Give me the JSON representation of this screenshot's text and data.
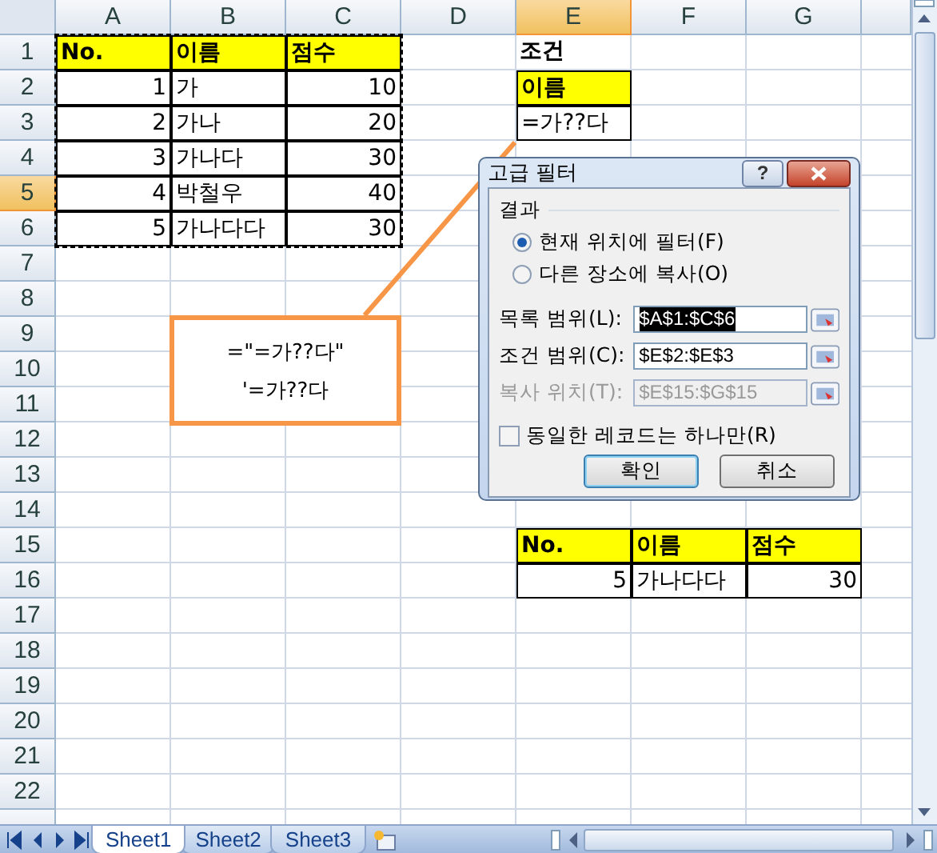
{
  "sheet": {
    "columns": [
      {
        "label": "A",
        "selected": false
      },
      {
        "label": "B",
        "selected": false
      },
      {
        "label": "C",
        "selected": false
      },
      {
        "label": "D",
        "selected": false
      },
      {
        "label": "E",
        "selected": true
      },
      {
        "label": "F",
        "selected": false
      },
      {
        "label": "G",
        "selected": false
      }
    ],
    "rows": [
      {
        "label": "1",
        "selected": false,
        "cells": {
          "A": {
            "text": "No.",
            "kind": "header"
          },
          "B": {
            "text": "이름",
            "kind": "header"
          },
          "C": {
            "text": "점수",
            "kind": "header"
          },
          "E": {
            "text": "조건",
            "kind": "title"
          }
        }
      },
      {
        "label": "2",
        "selected": false,
        "cells": {
          "A": {
            "text": "1",
            "kind": "number"
          },
          "B": {
            "text": "가",
            "kind": "text"
          },
          "C": {
            "text": "10",
            "kind": "number"
          },
          "E": {
            "text": "이름",
            "kind": "header"
          }
        }
      },
      {
        "label": "3",
        "selected": false,
        "cells": {
          "A": {
            "text": "2",
            "kind": "number"
          },
          "B": {
            "text": "가나",
            "kind": "text"
          },
          "C": {
            "text": "20",
            "kind": "number"
          },
          "E": {
            "text": "=가??다",
            "kind": "text"
          }
        }
      },
      {
        "label": "4",
        "selected": false,
        "cells": {
          "A": {
            "text": "3",
            "kind": "number"
          },
          "B": {
            "text": "가나다",
            "kind": "text"
          },
          "C": {
            "text": "30",
            "kind": "number"
          }
        }
      },
      {
        "label": "5",
        "selected": true,
        "cells": {
          "A": {
            "text": "4",
            "kind": "number"
          },
          "B": {
            "text": "박철우",
            "kind": "text"
          },
          "C": {
            "text": "40",
            "kind": "number"
          }
        }
      },
      {
        "label": "6",
        "selected": false,
        "cells": {
          "A": {
            "text": "5",
            "kind": "number"
          },
          "B": {
            "text": "가나다다",
            "kind": "text"
          },
          "C": {
            "text": "30",
            "kind": "number"
          }
        }
      },
      {
        "label": "7",
        "selected": false,
        "cells": {}
      },
      {
        "label": "8",
        "selected": false,
        "cells": {}
      },
      {
        "label": "9",
        "selected": false,
        "cells": {}
      },
      {
        "label": "10",
        "selected": false,
        "cells": {}
      },
      {
        "label": "11",
        "selected": false,
        "cells": {}
      },
      {
        "label": "12",
        "selected": false,
        "cells": {}
      },
      {
        "label": "13",
        "selected": false,
        "cells": {}
      },
      {
        "label": "14",
        "selected": false,
        "cells": {}
      },
      {
        "label": "15",
        "selected": false,
        "cells": {
          "E": {
            "text": "No.",
            "kind": "header"
          },
          "F": {
            "text": "이름",
            "kind": "header"
          },
          "G": {
            "text": "점수",
            "kind": "header"
          }
        }
      },
      {
        "label": "16",
        "selected": false,
        "cells": {
          "E": {
            "text": "5",
            "kind": "number"
          },
          "F": {
            "text": "가나다다",
            "kind": "text"
          },
          "G": {
            "text": "30",
            "kind": "number"
          }
        }
      },
      {
        "label": "17",
        "selected": false,
        "cells": {}
      },
      {
        "label": "18",
        "selected": false,
        "cells": {}
      },
      {
        "label": "19",
        "selected": false,
        "cells": {}
      },
      {
        "label": "20",
        "selected": false,
        "cells": {}
      },
      {
        "label": "21",
        "selected": false,
        "cells": {}
      },
      {
        "label": "22",
        "selected": false,
        "cells": {}
      }
    ]
  },
  "callout": {
    "lines": [
      "=\"=가??다\"",
      "'=가??다"
    ]
  },
  "dialog": {
    "title": "고급 필터",
    "help": "?",
    "section": "결과",
    "options": [
      {
        "label": "현재 위치에 필터(F)",
        "selected": true
      },
      {
        "label": "다른 장소에 복사(O)",
        "selected": false
      }
    ],
    "fields": [
      {
        "label": "목록 범위(L):",
        "value": "$A$1:$C$6",
        "value_selected": true,
        "disabled": false
      },
      {
        "label": "조건 범위(C):",
        "value": "$E$2:$E$3",
        "value_selected": false,
        "disabled": false
      },
      {
        "label": "복사 위치(T):",
        "value": "$E$15:$G$15",
        "value_selected": false,
        "disabled": true
      }
    ],
    "checkbox": {
      "label": "동일한 레코드는 하나만(R)",
      "checked": false
    },
    "buttons": [
      {
        "label": "확인",
        "default": true
      },
      {
        "label": "취소",
        "default": false
      }
    ]
  },
  "sheet_tabs": [
    {
      "label": "Sheet1",
      "selected": true
    },
    {
      "label": "Sheet2",
      "selected": false
    },
    {
      "label": "Sheet3",
      "selected": false
    }
  ]
}
